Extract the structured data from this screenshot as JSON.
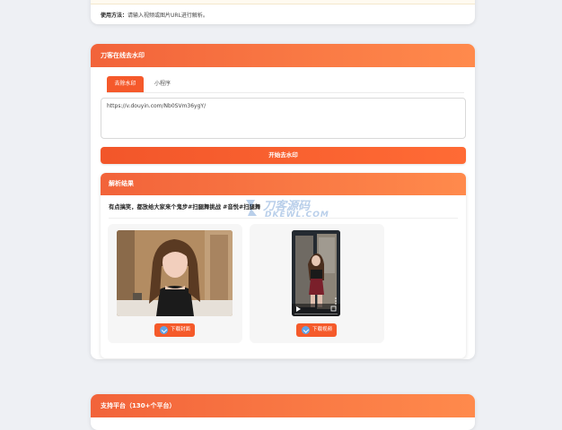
{
  "usage": {
    "label": "使用方法：",
    "text": "请输入视频或图片URL进行解析。"
  },
  "main_card": {
    "title": "刀客在线去水印",
    "tabs": [
      {
        "label": "去除水印",
        "active": true
      },
      {
        "label": "小程序",
        "active": false
      }
    ],
    "url_value": "https://v.douyin.com/Nb0SVm36ygY/",
    "start_button": "开始去水印"
  },
  "result": {
    "title": "解析结果",
    "video_title": "有点搞笑，都放给大家来个鬼步#扫腿舞挑战 #音悦#扫腿舞",
    "download_cover": "下载封面",
    "download_video": "下载视频"
  },
  "platforms": {
    "title": "支持平台（130+个平台）"
  },
  "watermark": {
    "cn": "刀客源码",
    "en": "DKEWL.COM"
  },
  "colors": {
    "accent": "#f5592b",
    "header_gradient_start": "#f2633a",
    "header_gradient_end": "#ff8a4c",
    "page_background": "#eef0f4",
    "download_icon": "#5ea3e8"
  },
  "icons": {
    "download": "download-icon",
    "play": "play-icon",
    "more": "more-icon",
    "fullscreen": "fullscreen-icon"
  }
}
